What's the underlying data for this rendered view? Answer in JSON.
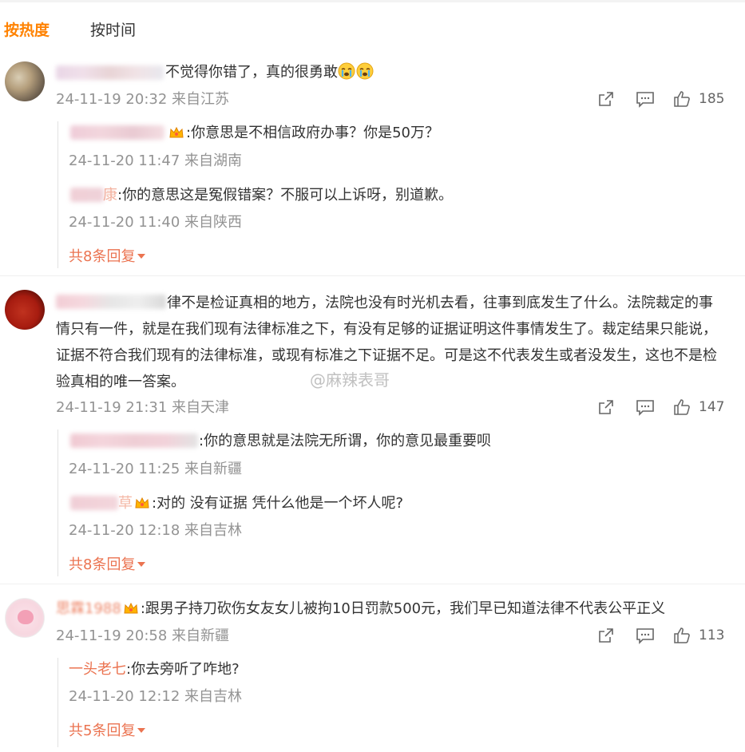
{
  "tabs": {
    "hot": "按热度",
    "time": "按时间"
  },
  "comments": [
    {
      "text": "不觉得你错了，真的很勇敢",
      "meta": "24-11-19 20:32 来自江苏",
      "likes": "185",
      "replies": [
        {
          "text": ":你意思是不相信政府办事？你是50万？",
          "meta": "24-11-20 11:47 来自湖南"
        },
        {
          "name_tail": "康",
          "text": ":你的意思这是冤假错案？不服可以上诉呀，别道歉。",
          "meta": "24-11-20 11:40 来自陕西"
        }
      ],
      "more": "共8条回复"
    },
    {
      "text": "律不是检证真相的地方，法院也没有时光机去看，往事到底发生了什么。法院裁定的事情只有一件，就是在我们现有法律标准之下，有没有足够的证据证明这件事情发生了。裁定结果只能说，证据不符合我们现有的法律标准，或现有标准之下证据不足。可是这不代表发生或者没发生，这也不是检验真相的唯一答案。",
      "meta": "24-11-19 21:31 来自天津",
      "likes": "147",
      "replies": [
        {
          "text": ":你的意思就是法院无所谓，你的意见最重要呗",
          "meta": "24-11-20 11:25 来自新疆"
        },
        {
          "name_tail": "草",
          "text": ":对的 没有证据 凭什么他是一个坏人呢?",
          "meta": "24-11-20 12:18 来自吉林"
        }
      ],
      "more": "共8条回复"
    },
    {
      "name": "思霖1988",
      "text": ":跟男子持刀砍伤女友女儿被拘10日罚款500元，我们早已知道法律不代表公平正义",
      "meta": "24-11-19 20:58 来自新疆",
      "likes": "113",
      "replies": [
        {
          "name": "一头老七",
          "text": ":你去旁听了咋地?",
          "meta": "24-11-20 12:12 来自吉林"
        }
      ],
      "more": "共5条回复"
    }
  ],
  "watermark": "@麻辣表哥",
  "colors": {
    "accent": "#ff8200",
    "name": "#eb7350",
    "meta": "#939393",
    "text": "#333333"
  },
  "icons": [
    "share-icon",
    "comment-icon",
    "like-icon",
    "caret-down-icon",
    "crown-icon",
    "crying-emoji-icon"
  ]
}
